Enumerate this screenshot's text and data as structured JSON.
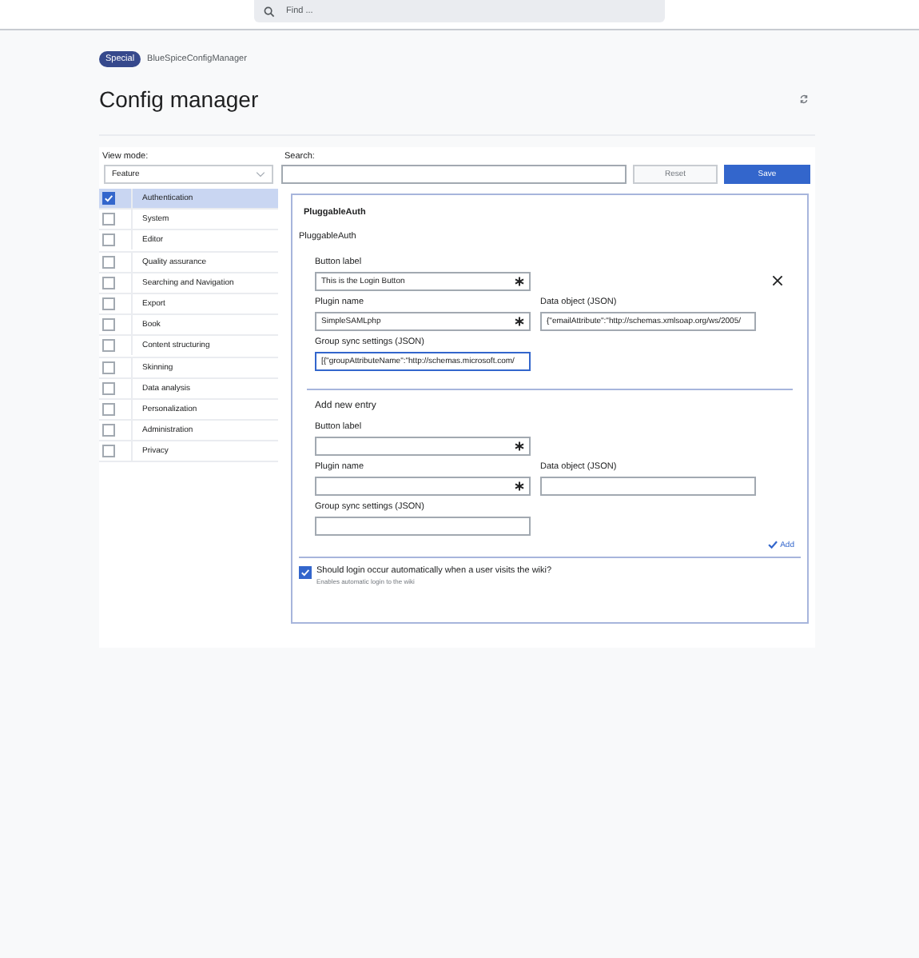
{
  "header": {
    "search_placeholder": "Find ..."
  },
  "breadcrumb": {
    "badge": "Special",
    "page": "BlueSpiceConfigManager"
  },
  "title": "Config manager",
  "view_mode": {
    "label": "View mode:",
    "value": "Feature"
  },
  "categories": [
    {
      "label": "Authentication",
      "selected": true
    },
    {
      "label": "System",
      "selected": false
    },
    {
      "label": "Editor",
      "selected": false
    },
    {
      "label": "Quality assurance",
      "selected": false
    },
    {
      "label": "Searching and Navigation",
      "selected": false
    },
    {
      "label": "Export",
      "selected": false
    },
    {
      "label": "Book",
      "selected": false
    },
    {
      "label": "Content structuring",
      "selected": false
    },
    {
      "label": "Skinning",
      "selected": false
    },
    {
      "label": "Data analysis",
      "selected": false
    },
    {
      "label": "Personalization",
      "selected": false
    },
    {
      "label": "Administration",
      "selected": false
    },
    {
      "label": "Privacy",
      "selected": false
    }
  ],
  "search": {
    "label": "Search:"
  },
  "buttons": {
    "reset": "Reset",
    "save": "Save"
  },
  "section": {
    "title": "PluggableAuth",
    "subtitle": "PluggableAuth",
    "entry": {
      "fields": [
        {
          "label": "Button label",
          "value": "This is the Login Button",
          "required": true,
          "focused": false
        },
        {
          "label": "Plugin name",
          "value": "SimpleSAMLphp",
          "required": true,
          "focused": false
        },
        {
          "label": "Data object (JSON)",
          "value": "{\"emailAttribute\":\"http://schemas.xmlsoap.org/ws/2005/",
          "required": false,
          "focused": false
        },
        {
          "label": "Group sync settings (JSON)",
          "value": "[{\"groupAttributeName\":\"http://schemas.microsoft.com/",
          "required": false,
          "focused": true
        }
      ]
    },
    "new_entry": {
      "title": "Add new entry",
      "add": "Add",
      "fields": [
        {
          "label": "Button label",
          "required": true,
          "focused": false
        },
        {
          "label": "Plugin name",
          "required": true,
          "focused": false
        },
        {
          "label": "Data object (JSON)",
          "required": false,
          "focused": false
        },
        {
          "label": "Group sync settings (JSON)",
          "required": false,
          "focused": false
        }
      ]
    }
  },
  "auto_login": {
    "label": "Should login occur automatically when a user visits the wiki?",
    "hint": "Enables automatic login to the wiki",
    "checked": true
  }
}
